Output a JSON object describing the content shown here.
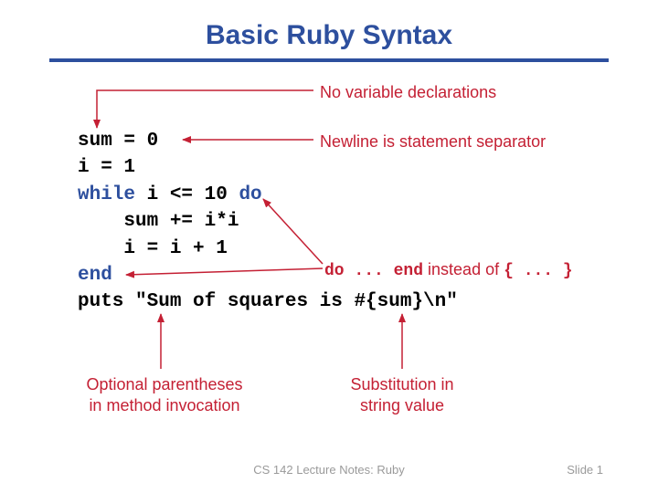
{
  "title": "Basic Ruby Syntax",
  "code": {
    "l1a": "sum = 0",
    "l2a": "i = 1",
    "l3a": "while",
    "l3b": " i <= 10 ",
    "l3c": "do",
    "l4a": "    sum += i*i",
    "l5a": "    i = i + 1",
    "l6a": "end",
    "l7a": "puts \"Sum of squares is #{sum}\\n\""
  },
  "annotations": {
    "no_decl": "No variable declarations",
    "newline_sep": "Newline is statement separator",
    "do_end_1": "do ... end",
    "do_end_2": " instead of ",
    "do_end_3": "{ ... }",
    "opt_paren_1": "Optional parentheses",
    "opt_paren_2": "in method invocation",
    "subst_1": "Substitution in",
    "subst_2": "string value"
  },
  "footer": {
    "left": "CS 142 Lecture Notes: Ruby",
    "right": "Slide 1"
  },
  "colors": {
    "accent": "#2d4f9e",
    "annotation": "#c42034"
  }
}
